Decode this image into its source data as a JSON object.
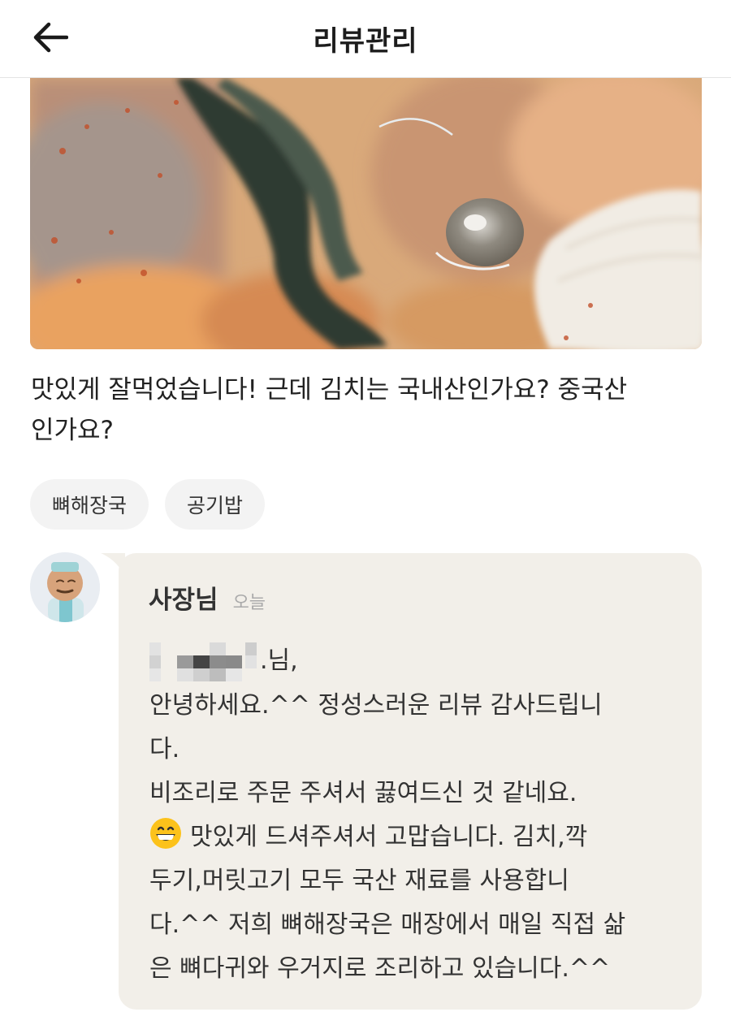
{
  "header": {
    "title": "리뷰관리",
    "back_icon": "arrow-left-icon"
  },
  "review": {
    "photo_icon": "food-photo",
    "text": "맛있게 잘먹었습니다! 근데 김치는 국내산인가요? 중국산인가요?",
    "text_lines": [
      "맛있게 잘먹었습니다! 근데 김치는 국내산인가요? 중국산",
      "인가요?"
    ],
    "tags": [
      "뼈해장국",
      "공기밥"
    ]
  },
  "reply": {
    "avatar_icon": "owner-avatar",
    "owner_name": "사장님",
    "date": "오늘",
    "greeting_suffix": ".님,",
    "lines": [
      "안녕하세요.^^ 정성스러운 리뷰 감사드립니",
      "다.",
      "비조리로 주문 주셔서 끓여드신 것 같네요.",
      "맛있게 드셔주셔서 고맙습니다. 김치,깍",
      "두기,머릿고기 모두 국산 재료를 사용합니",
      "다.^^ 저희 뼈해장국은 매장에서 매일 직접 삶",
      "은 뼈다귀와 우거지로 조리하고 있습니다.^^"
    ],
    "emoji_icon": "grinning-face-icon"
  },
  "colors": {
    "bubble_bg": "#f2efe9",
    "tag_bg": "#f3f3f3",
    "text": "#222222"
  }
}
